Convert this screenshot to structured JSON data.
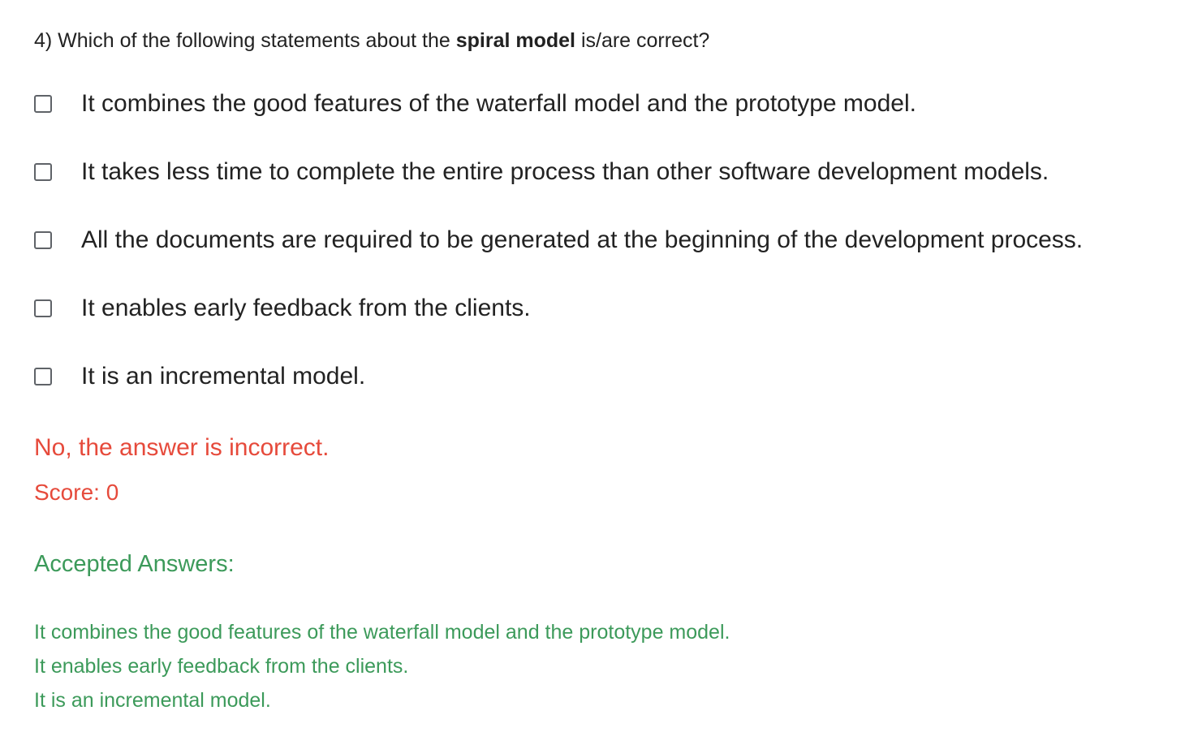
{
  "question": {
    "prefix": "4) Which of the following statements about the ",
    "emphasis": "spiral model",
    "suffix": " is/are correct?"
  },
  "options": [
    {
      "label": "It combines the good features of the waterfall model and the prototype model.",
      "checked": false
    },
    {
      "label": "It takes less time to complete the entire process than other software development models.",
      "checked": false
    },
    {
      "label": "All the documents are required to be generated at the beginning of the development process.",
      "checked": false
    },
    {
      "label": "It enables early feedback from the clients.",
      "checked": false
    },
    {
      "label": "It is an incremental model.",
      "checked": false
    }
  ],
  "feedback": {
    "message": "No, the answer is incorrect.",
    "score": "Score: 0"
  },
  "accepted": {
    "title": "Accepted Answers:",
    "answers": [
      "It combines the good features of the waterfall model and the prototype model.",
      "It enables early feedback from the clients.",
      "It is an incremental model."
    ]
  },
  "colors": {
    "incorrect": "#e64a3b",
    "accepted": "#3c9a5a"
  }
}
